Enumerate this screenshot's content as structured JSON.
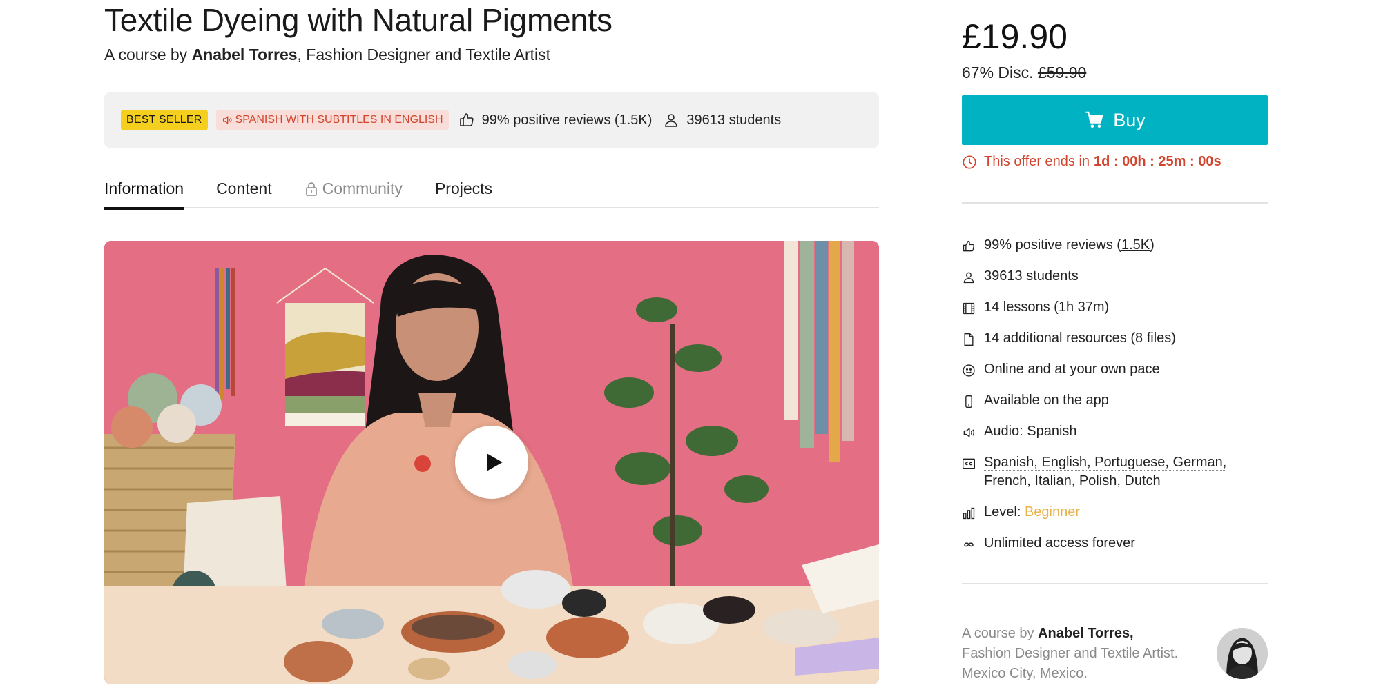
{
  "course": {
    "title": "Textile Dyeing with Natural Pigments",
    "byline_prefix": "A course by ",
    "author_name": "Anabel Torres",
    "byline_suffix": ", Fashion Designer and Textile Artist"
  },
  "infobar": {
    "badge_best": "BEST SELLER",
    "badge_lang": "SPANISH WITH SUBTITLES IN ENGLISH",
    "reviews": "99% positive reviews (1.5K)",
    "students": "39613 students"
  },
  "tabs": [
    {
      "label": "Information"
    },
    {
      "label": "Content"
    },
    {
      "label": "Community"
    },
    {
      "label": "Projects"
    }
  ],
  "pricing": {
    "price": "£19.90",
    "discount_prefix": "67% Disc. ",
    "old_price": "£59.90",
    "buy_label": "Buy",
    "offer_prefix": "This offer ends in",
    "offer_countdown": "1d : 00h : 25m : 00s"
  },
  "features": {
    "reviews_prefix": "99% positive reviews (",
    "reviews_count": "1.5K",
    "reviews_suffix": ")",
    "students": "39613 students",
    "lessons": "14 lessons (1h 37m)",
    "resources": "14 additional resources (8 files)",
    "pace": "Online and at your own pace",
    "app": "Available on the app",
    "audio": "Audio: Spanish",
    "subtitles_line1": "Spanish, English, Portuguese, German,",
    "subtitles_line2": "French, Italian, Polish, Dutch",
    "level_label": "Level: ",
    "level_value": "Beginner",
    "access": "Unlimited access forever"
  },
  "author_card": {
    "prefix": "A course by ",
    "name": "Anabel Torres,",
    "line2": "Fashion Designer and Textile Artist.",
    "line3": "Mexico City, Mexico."
  },
  "colors": {
    "accent_buy": "#00b2c2",
    "offer_red": "#d2442d",
    "badge_yellow": "#f5cf1e",
    "level_gold": "#e9b24a"
  },
  "icons": {
    "thumb": "thumbs-up-icon",
    "user": "user-icon",
    "cart": "cart-icon",
    "clock": "clock-icon",
    "play": "play-icon",
    "lock": "lock-icon",
    "speaker": "speaker-icon"
  }
}
